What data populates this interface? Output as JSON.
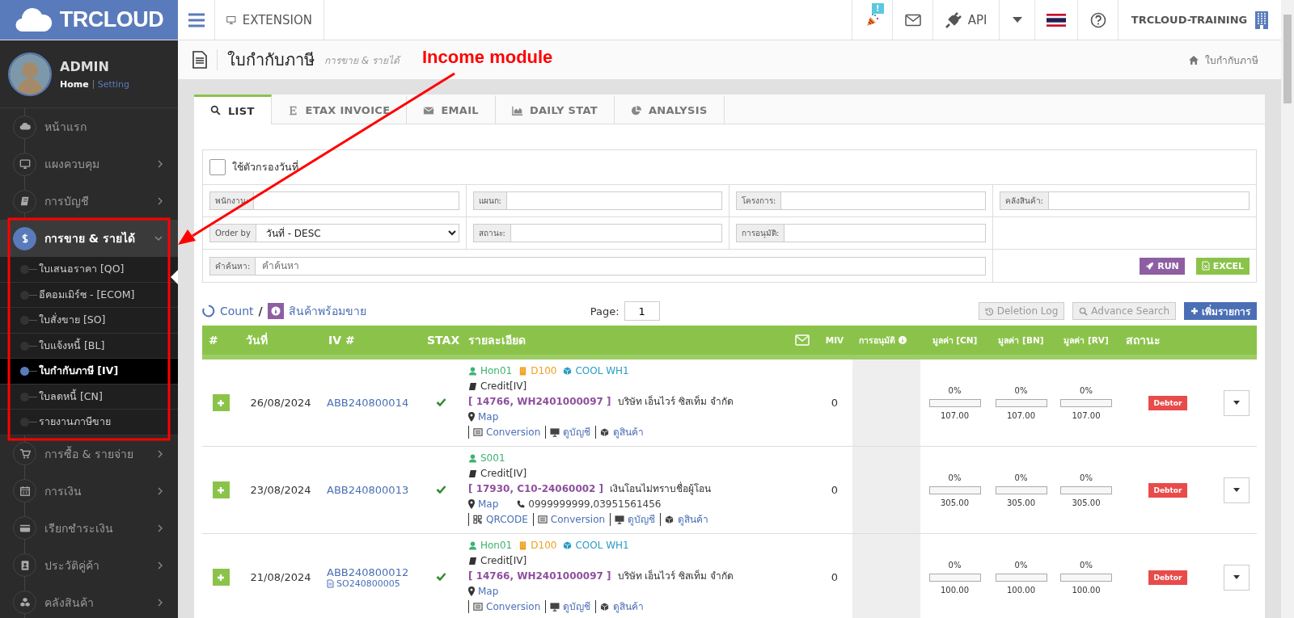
{
  "topbar": {
    "logo_text": "**TR**CLOUD",
    "extension": "EXTENSION",
    "notification_badge": "!",
    "api": "API",
    "company": "TRCLOUD-TRAINING"
  },
  "user": {
    "name": "ADMIN",
    "home": "Home",
    "setting": "Setting"
  },
  "sidebar": {
    "items": [
      {
        "label": "หน้าแรก",
        "kind": "link",
        "expanded": false
      },
      {
        "label": "แผงควบคุม",
        "kind": "menu",
        "expanded": false
      },
      {
        "label": "การบัญชี",
        "kind": "menu",
        "expanded": false
      },
      {
        "label": "การขาย & รายได้",
        "kind": "menu",
        "expanded": true,
        "children": [
          {
            "label": "ใบเสนอราคา [QO]",
            "selected": false
          },
          {
            "label": "อีคอมเมิร์ซ - [ECOM]",
            "selected": false
          },
          {
            "label": "ใบสั่งขาย [SO]",
            "selected": false
          },
          {
            "label": "ใบแจ้งหนี้ [BL]",
            "selected": false
          },
          {
            "label": "ใบกำกับภาษี [IV]",
            "selected": true
          },
          {
            "label": "ใบลดหนี้ [CN]",
            "selected": false
          },
          {
            "label": "รายงานภาษีขาย",
            "selected": false
          }
        ]
      },
      {
        "label": "การซื้อ & รายจ่าย",
        "kind": "menu",
        "expanded": false
      },
      {
        "label": "การเงิน",
        "kind": "menu",
        "expanded": false
      },
      {
        "label": "เรียกชำระเงิน",
        "kind": "menu",
        "expanded": false
      },
      {
        "label": "ประวัติคู่ค้า",
        "kind": "menu",
        "expanded": false
      },
      {
        "label": "คลังสินค้า",
        "kind": "menu",
        "expanded": false
      }
    ]
  },
  "page": {
    "title": "ใบกำกับภาษี",
    "subtitle": "การขาย & รายได้",
    "breadcrumb": "ใบกำกับภาษี"
  },
  "annotation": {
    "text": "Income module"
  },
  "tabs": [
    {
      "label": "LIST",
      "selected": true
    },
    {
      "label": "ETAX INVOICE",
      "selected": false
    },
    {
      "label": "EMAIL",
      "selected": false
    },
    {
      "label": "DAILY STAT",
      "selected": false
    },
    {
      "label": "ANALYSIS",
      "selected": false
    }
  ],
  "filters": {
    "date_filter": {
      "label": "ใช้ตัวกรองวันที่",
      "checked": false
    },
    "fields": [
      {
        "label": "พนักงาน:",
        "kind": "input"
      },
      {
        "label": "แผนก:",
        "kind": "input"
      },
      {
        "label": "โครงการ:",
        "kind": "input"
      },
      {
        "label": "คลังสินค้า:",
        "kind": "input"
      },
      {
        "label": "Order by",
        "kind": "select",
        "value": "วันที่ - DESC"
      },
      {
        "label": "สถานะ:",
        "kind": "input"
      },
      {
        "label": "การอนุมัติ:",
        "kind": "input"
      }
    ],
    "search": {
      "label": "คำค้นหา:",
      "placeholder": "คำค้นหา"
    },
    "buttons": [
      {
        "label": "RUN",
        "kind": "run"
      },
      {
        "label": "EXCEL",
        "kind": "excel"
      }
    ]
  },
  "toolbar": {
    "count": "Count",
    "separator": "/",
    "stock_link": "สินค้าพร้อมขาย",
    "page_label": "Page:",
    "page": "1",
    "buttons": [
      {
        "label": "Deletion Log",
        "kind": "log"
      },
      {
        "label": "Advance Search",
        "kind": "search"
      },
      {
        "label": "เพิ่มรายการ",
        "kind": "add"
      }
    ]
  },
  "table": {
    "columns": [
      {
        "label": "#",
        "kind": "text"
      },
      {
        "label": "วันที่",
        "kind": "text"
      },
      {
        "label": "IV #",
        "kind": "text"
      },
      {
        "label": "STAX",
        "kind": "text"
      },
      {
        "label": "รายละเอียด",
        "kind": "text"
      },
      {
        "kind": "mail"
      },
      {
        "label": "MIV",
        "kind": "small"
      },
      {
        "label": "การอนุมัติ",
        "kind": "info"
      },
      {
        "label": "มูลค่า [CN]",
        "kind": "small"
      },
      {
        "label": "มูลค่า [BN]",
        "kind": "small"
      },
      {
        "label": "มูลค่า [RV]",
        "kind": "small"
      },
      {
        "label": "สถานะ",
        "kind": "text"
      }
    ],
    "rows": [
      {
        "date": "26/08/2024",
        "iv": "ABB240800014",
        "stax": true,
        "tags": [
          {
            "text": "Hon01",
            "kind": "user"
          },
          {
            "text": "D100",
            "kind": "department"
          },
          {
            "text": "COOL WH1",
            "kind": "warehouse"
          }
        ],
        "payment": "Credit[IV]",
        "ref": "[ 14766, WH2401000097 ]",
        "customer": "บริษัท เอ็นไวร์ ซิสเท็ม จำกัด",
        "map": "Map",
        "links": [
          {
            "text": "Conversion",
            "kind": "conversion"
          },
          {
            "text": "ดูบัญชี",
            "kind": "account"
          },
          {
            "text": "ดูสินค้า",
            "kind": "product"
          }
        ],
        "miv": "0",
        "values": [
          {
            "percent": "0%",
            "level": 0,
            "amount": "107.00"
          },
          {
            "percent": "0%",
            "level": 0,
            "amount": "107.00"
          },
          {
            "percent": "0%",
            "level": 0,
            "amount": "107.00"
          }
        ],
        "status": "Debtor"
      },
      {
        "date": "23/08/2024",
        "iv": "ABB240800013",
        "stax": true,
        "tags": [
          {
            "text": "S001",
            "kind": "user"
          }
        ],
        "payment": "Credit[IV]",
        "ref": "[ 17930, C10-24060002 ]",
        "customer": "เงินโอนไม่ทราบชื่อผู้โอน",
        "map": "Map",
        "phone": "0999999999,03951561456",
        "links": [
          {
            "text": "QRCODE",
            "kind": "qrcode"
          },
          {
            "text": "Conversion",
            "kind": "conversion"
          },
          {
            "text": "ดูบัญชี",
            "kind": "account"
          },
          {
            "text": "ดูสินค้า",
            "kind": "product"
          }
        ],
        "miv": "0",
        "values": [
          {
            "percent": "0%",
            "level": 0,
            "amount": "305.00"
          },
          {
            "percent": "0%",
            "level": 0,
            "amount": "305.00"
          },
          {
            "percent": "0%",
            "level": 0,
            "amount": "305.00"
          }
        ],
        "status": "Debtor"
      },
      {
        "date": "21/08/2024",
        "iv": "ABB240800012",
        "so": "SO240800005",
        "stax": true,
        "tags": [
          {
            "text": "Hon01",
            "kind": "user"
          },
          {
            "text": "D100",
            "kind": "department"
          },
          {
            "text": "COOL WH1",
            "kind": "warehouse"
          }
        ],
        "payment": "Credit[IV]",
        "ref": "[ 14766, WH2401000097 ]",
        "customer": "บริษัท เอ็นไวร์ ซิสเท็ม จำกัด",
        "map": "Map",
        "links": [
          {
            "text": "Conversion",
            "kind": "conversion"
          },
          {
            "text": "ดูบัญชี",
            "kind": "account"
          },
          {
            "text": "ดูสินค้า",
            "kind": "product"
          }
        ],
        "miv": "0",
        "values": [
          {
            "percent": "0%",
            "level": 0,
            "amount": "100.00"
          },
          {
            "percent": "0%",
            "level": 0,
            "amount": "100.00"
          },
          {
            "percent": "0%",
            "level": 0,
            "amount": "100.00"
          }
        ],
        "status": "Debtor"
      }
    ]
  }
}
